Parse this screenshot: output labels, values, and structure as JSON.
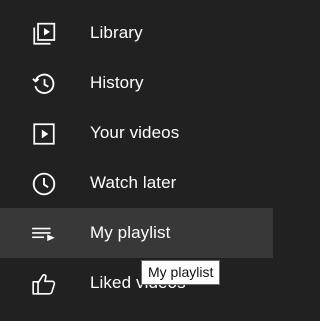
{
  "menu": {
    "items": [
      {
        "label": "Library",
        "icon": "library-icon"
      },
      {
        "label": "History",
        "icon": "history-icon"
      },
      {
        "label": "Your videos",
        "icon": "play-icon"
      },
      {
        "label": "Watch later",
        "icon": "clock-icon"
      },
      {
        "label": "My playlist",
        "icon": "playlist-icon",
        "active": true
      },
      {
        "label": "Liked videos",
        "icon": "thumbs-up-icon"
      }
    ]
  },
  "tooltip": {
    "text": "My playlist"
  },
  "colors": {
    "background": "#212121",
    "active_row": "#383838",
    "text": "#ffffff",
    "tooltip_bg": "#ffffff",
    "tooltip_text": "#111111"
  }
}
